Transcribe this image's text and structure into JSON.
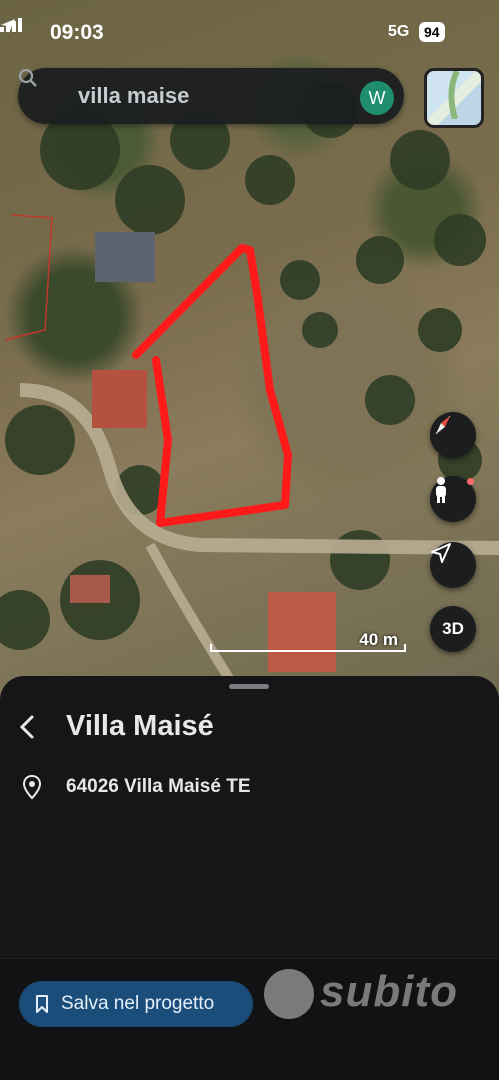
{
  "status_bar": {
    "time": "09:03",
    "network": "5G",
    "battery": "94"
  },
  "search": {
    "query": "villa maise",
    "avatar_letter": "W"
  },
  "map": {
    "scale_label": "40 m"
  },
  "map_controls": {
    "three_d_label": "3D"
  },
  "place": {
    "title": "Villa Maisé",
    "address": "64026 Villa Maisé TE"
  },
  "actions": {
    "save_label": "Salva nel progetto"
  },
  "watermark": {
    "text": "subito"
  },
  "colors": {
    "accent": "#1b4d7a",
    "avatar": "#1e8e6e",
    "boundary": "#ff1a1a"
  }
}
